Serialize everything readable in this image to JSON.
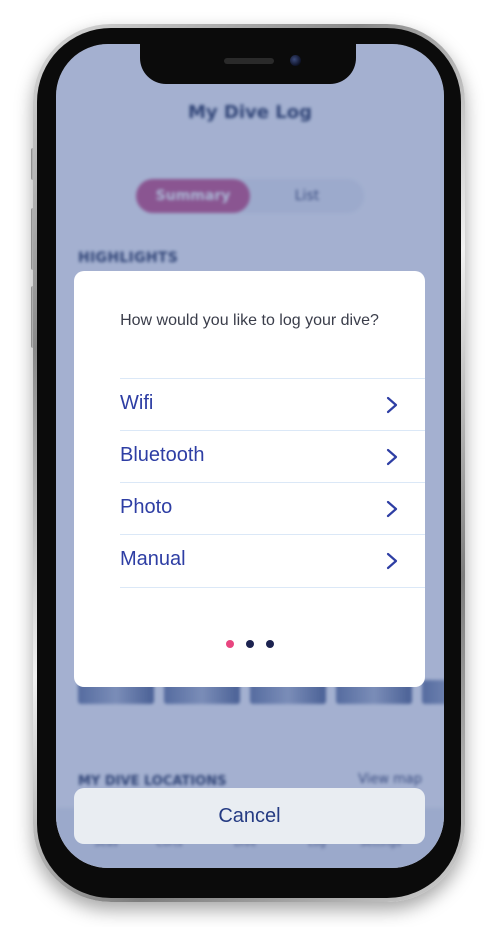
{
  "background_app": {
    "title": "My Dive Log",
    "segments": [
      "Summary",
      "List"
    ],
    "active_segment": "Summary",
    "highlights_label": "HIGHLIGHTS",
    "locations_label": "MY DIVE LOCATIONS",
    "view_map_label": "View map",
    "tabs": [
      "Seas",
      "Corts",
      "Dive",
      "Log",
      "Settings"
    ],
    "accent_color": "#c8598c"
  },
  "modal": {
    "question": "How would you like to log your dive?",
    "options": [
      {
        "label": "Wifi",
        "icon": "chevron-right-icon"
      },
      {
        "label": "Bluetooth",
        "icon": "chevron-right-icon"
      },
      {
        "label": "Photo",
        "icon": "chevron-right-icon"
      },
      {
        "label": "Manual",
        "icon": "chevron-right-icon"
      }
    ],
    "pagination": {
      "total": 3,
      "active_index": 0,
      "active_color": "#e8457f",
      "inactive_color": "#1c2350"
    },
    "option_text_color": "#2e3ea4"
  },
  "cancel": {
    "label": "Cancel"
  }
}
